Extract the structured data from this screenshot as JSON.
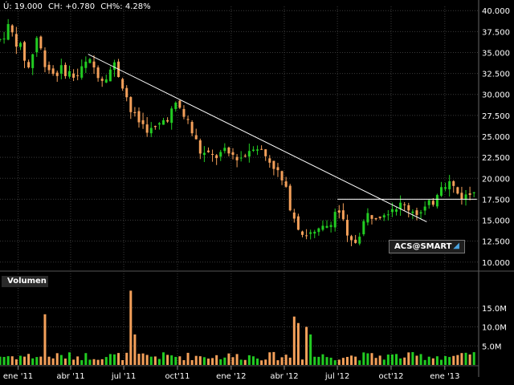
{
  "info": {
    "last": "Ú: 19.000",
    "change": "CH: +0.780",
    "change_pct": "CH%: 4.28%"
  },
  "badge": {
    "label": "ACS@SMART",
    "icon": "chart-arrow-icon"
  },
  "volume_panel": {
    "label": "Volumen"
  },
  "colors": {
    "up": "#22cc22",
    "down": "#f4a05a",
    "trendline": "#ffffff",
    "grid": "#3a3a3a",
    "background": "#000000"
  },
  "chart_data": [
    {
      "type": "candlestick",
      "title": "",
      "price_axis": {
        "ylim": [
          9.5,
          40.5
        ],
        "ticks": [
          "10.000",
          "12.500",
          "15.000",
          "17.500",
          "20.000",
          "22.500",
          "25.000",
          "27.500",
          "30.000",
          "32.500",
          "35.000",
          "37.500",
          "40.000"
        ],
        "position": "right"
      },
      "x_axis": {
        "tick_labels": [
          "ene '11",
          "abr '11",
          "jul '11",
          "oct'11",
          "ene '12",
          "abr '12",
          "jul '12",
          "oct'12",
          "ene '13"
        ],
        "range": [
          "2010-12",
          "2013-02"
        ]
      },
      "anchors": [
        [
          "2010-12-01",
          36.5
        ],
        [
          "2010-12-15",
          38.0
        ],
        [
          "2011-01-05",
          35.5
        ],
        [
          "2011-01-20",
          33.0
        ],
        [
          "2011-02-01",
          37.0
        ],
        [
          "2011-02-15",
          34.0
        ],
        [
          "2011-03-01",
          32.5
        ],
        [
          "2011-03-20",
          33.0
        ],
        [
          "2011-04-10",
          32.0
        ],
        [
          "2011-05-01",
          34.0
        ],
        [
          "2011-05-25",
          32.0
        ],
        [
          "2011-06-15",
          33.5
        ],
        [
          "2011-07-01",
          31.0
        ],
        [
          "2011-07-15",
          27.5
        ],
        [
          "2011-08-01",
          26.5
        ],
        [
          "2011-08-20",
          25.5
        ],
        [
          "2011-09-15",
          27.5
        ],
        [
          "2011-10-01",
          28.8
        ],
        [
          "2011-10-20",
          26.5
        ],
        [
          "2011-11-10",
          23.0
        ],
        [
          "2011-12-01",
          22.5
        ],
        [
          "2011-12-20",
          23.0
        ],
        [
          "2012-01-20",
          22.5
        ],
        [
          "2012-02-10",
          24.2
        ],
        [
          "2012-02-25",
          23.0
        ],
        [
          "2012-03-15",
          21.5
        ],
        [
          "2012-04-01",
          19.0
        ],
        [
          "2012-04-15",
          16.0
        ],
        [
          "2012-05-01",
          13.5
        ],
        [
          "2012-05-25",
          13.2
        ],
        [
          "2012-06-15",
          14.5
        ],
        [
          "2012-07-01",
          16.5
        ],
        [
          "2012-07-10",
          15.0
        ],
        [
          "2012-07-20",
          12.0
        ],
        [
          "2012-08-01",
          12.5
        ],
        [
          "2012-08-20",
          15.5
        ],
        [
          "2012-09-15",
          16.0
        ],
        [
          "2012-10-10",
          16.8
        ],
        [
          "2012-11-01",
          16.5
        ],
        [
          "2012-11-20",
          15.8
        ],
        [
          "2012-12-10",
          17.0
        ],
        [
          "2012-12-25",
          19.5
        ],
        [
          "2013-01-10",
          19.5
        ],
        [
          "2013-01-25",
          18.0
        ],
        [
          "2013-02-10",
          17.8
        ],
        [
          "2013-02-20",
          19.0
        ]
      ],
      "trendlines": [
        {
          "from": [
            "2011-05-01",
            34.8
          ],
          "to": [
            "2012-12-01",
            14.8
          ],
          "color": "#ffffff"
        },
        {
          "from": [
            "2012-07-01",
            17.5
          ],
          "to": [
            "2013-02-25",
            17.5
          ],
          "color": "#ffffff"
        }
      ]
    },
    {
      "type": "bar",
      "name": "Volumen",
      "ylim": [
        0,
        20000000
      ],
      "ticks": [
        "5.0M",
        "10.0M",
        "15.0M"
      ],
      "spikes": [
        [
          "2011-02-15",
          13.3
        ],
        [
          "2011-07-10",
          19.5
        ],
        [
          "2011-07-20",
          8.0
        ],
        [
          "2012-04-20",
          12.7
        ],
        [
          "2012-04-25",
          11.0
        ],
        [
          "2012-05-10",
          10.0
        ],
        [
          "2012-05-15",
          8.0
        ]
      ]
    }
  ]
}
